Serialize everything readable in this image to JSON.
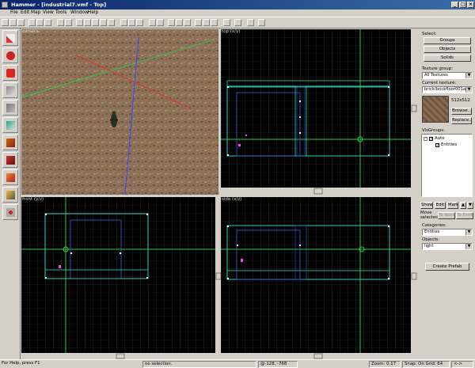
{
  "window": {
    "title": "Hammer - [industrial7.vmf - Top]"
  },
  "menu": [
    "File",
    "Edit",
    "Map",
    "View",
    "Tools",
    "Window",
    "Help"
  ],
  "viewports": {
    "camera": {
      "label": "camera"
    },
    "top": {
      "label": "top (x/y)"
    },
    "front": {
      "label": "front (y/z)"
    },
    "side": {
      "label": "side (x/z)"
    }
  },
  "panel": {
    "select_label": "Select:",
    "groups": "Groups",
    "objects": "Objects",
    "solids": "Solids",
    "texture_group_label": "Texture group:",
    "texture_group_value": "All Textures",
    "current_texture_label": "Current texture:",
    "current_texture_value": "brick/brickfloor001a",
    "texture_size": "512x512",
    "browse": "Browse...",
    "replace": "Replace...",
    "visgroups_label": "VisGroups:",
    "visgroup_auto": "Auto",
    "visgroup_entities": "Entities",
    "show": "Show",
    "edit": "Edit",
    "mark": "Mark",
    "move_selected_label": "Move selected:",
    "to_world": "To World",
    "to_entity": "To Entity",
    "categories_label": "Categories:",
    "categories_value": "Entities",
    "objects_label": "Objects:",
    "objects_value": "light",
    "create_prefab": "Create Prefab"
  },
  "status": {
    "help": "For Help, press F1",
    "selection": "no selection.",
    "coords": "@-128, -768",
    "zoom": "Zoom: 0.17",
    "snap": "Snap: On Grid: 64",
    "extra": "<->"
  },
  "colors": {
    "grid": "#3a3a3a",
    "brush_cyan": "#30d0c0",
    "brush_blue": "#3a5fd0",
    "axis_green": "#2ecc40",
    "entity_magenta": "#ff40ff"
  }
}
